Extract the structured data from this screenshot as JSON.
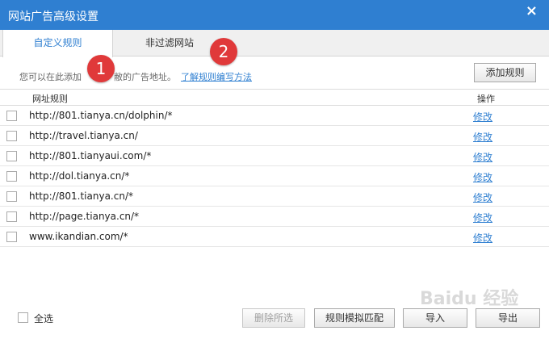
{
  "window": {
    "title": "网站广告高级设置",
    "close_glyph": "×"
  },
  "tabs": [
    {
      "label": "自定义规则",
      "active": true
    },
    {
      "label": "非过滤网站",
      "active": false
    }
  ],
  "annotations": [
    "1",
    "2"
  ],
  "hint": {
    "text": "您可以在此添加",
    "text_hidden_end": "敝的广告地址。",
    "link": "了解规则编写方法"
  },
  "add_rule_button": "添加规则",
  "table": {
    "headers": {
      "url": "网址规则",
      "op": "操作"
    },
    "edit_label": "修改",
    "rows": [
      "http://801.tianya.cn/dolphin/*",
      "http://travel.tianya.cn/",
      "http://801.tianyaui.com/*",
      "http://dol.tianya.cn/*",
      "http://801.tianya.cn/*",
      "http://page.tianya.cn/*",
      "www.ikandian.com/*"
    ]
  },
  "footer": {
    "select_all": "全选",
    "delete_selected": "删除所选",
    "simulate_match": "规则模拟匹配",
    "import": "导入",
    "export": "导出"
  },
  "watermark": "Baidu 经验",
  "colors": {
    "accent": "#2f7fd1",
    "badge": "#e0393a"
  }
}
